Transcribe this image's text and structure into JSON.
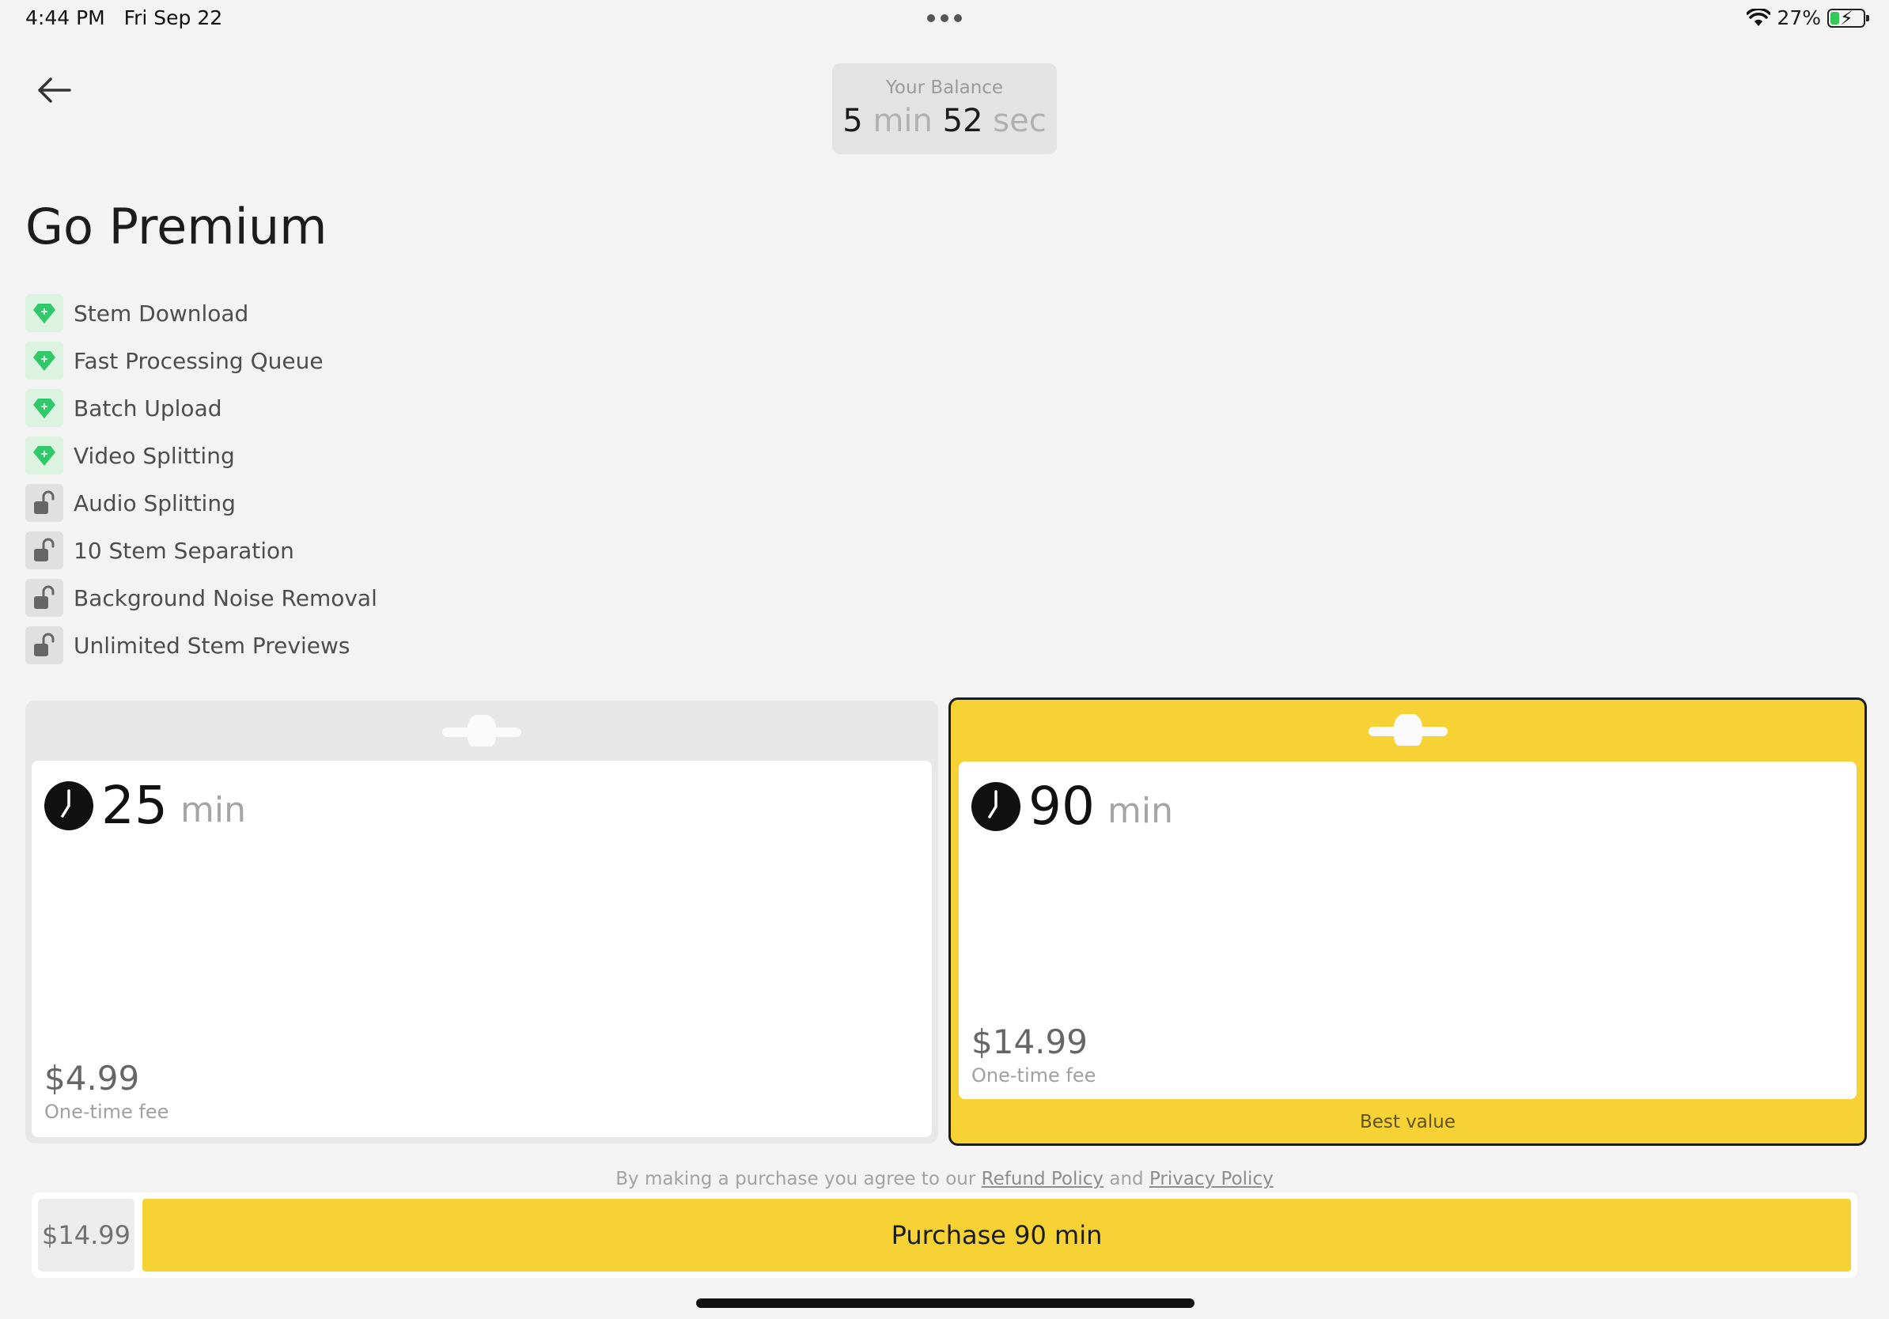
{
  "status": {
    "time": "4:44 PM",
    "date": "Fri Sep 22",
    "battery": "27%",
    "battery_level": 0.27
  },
  "balance": {
    "label": "Your Balance",
    "minutes": "5",
    "min_unit": "min",
    "seconds": "52",
    "sec_unit": "sec"
  },
  "title": "Go Premium",
  "features": [
    {
      "label": "Stem Download",
      "icon": "gem-icon",
      "unlocked": true
    },
    {
      "label": "Fast Processing Queue",
      "icon": "gem-icon",
      "unlocked": true
    },
    {
      "label": "Batch Upload",
      "icon": "gem-icon",
      "unlocked": true
    },
    {
      "label": "Video Splitting",
      "icon": "gem-icon",
      "unlocked": true
    },
    {
      "label": "Audio Splitting",
      "icon": "unlock-icon",
      "unlocked": false
    },
    {
      "label": "10 Stem Separation",
      "icon": "unlock-icon",
      "unlocked": false
    },
    {
      "label": "Background Noise Removal",
      "icon": "unlock-icon",
      "unlocked": false
    },
    {
      "label": "Unlimited Stem Previews",
      "icon": "unlock-icon",
      "unlocked": false
    }
  ],
  "plans": [
    {
      "amount": "25",
      "unit": "min",
      "price": "$4.99",
      "fee": "One-time fee",
      "selected": false
    },
    {
      "amount": "90",
      "unit": "min",
      "price": "$14.99",
      "fee": "One-time fee",
      "badge": "Best value",
      "selected": true
    }
  ],
  "terms": {
    "prefix": "By making a purchase you agree to our",
    "refund": "Refund Policy",
    "and": "and",
    "privacy": "Privacy Policy"
  },
  "purchase": {
    "price": "$14.99",
    "button_label": "Purchase 90 min"
  },
  "colors": {
    "accent": "#f7d234",
    "gem": "#2fc96a",
    "background": "#f3f3f3"
  }
}
